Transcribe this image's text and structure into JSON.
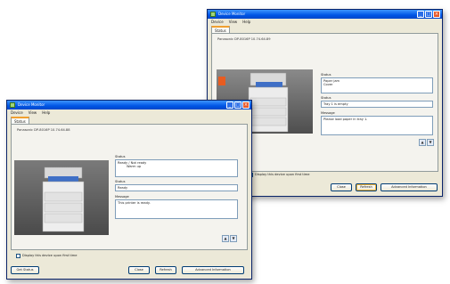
{
  "back": {
    "title": "Device Monitor",
    "menu": [
      "Device",
      "View",
      "Help"
    ],
    "tab": "Status",
    "header": "Panasonic DP-8016P 10.74.64.89",
    "status_label": "Status",
    "status_value": [
      "Paper jam",
      "Cover"
    ],
    "status2_label": "Status",
    "status2_value": "Tray 1 is empty",
    "message_label": "Message",
    "message_value": "Please load paper in tray 1.",
    "checkbox_label": "Display this device upon first time",
    "buttons": {
      "close": "Close",
      "refresh": "Refresh",
      "advanced": "Advanced Information"
    },
    "scroll": {
      "up": "▲",
      "down": "▼"
    }
  },
  "front": {
    "title": "Device Monitor",
    "menu": [
      "Device",
      "View",
      "Help"
    ],
    "tab": "Status",
    "header": "Panasonic DP-8016P 10.74.64.88",
    "status_label": "Status",
    "status_value": [
      "Ready / Not ready",
      "Warm up"
    ],
    "status2_label": "Status",
    "status2_value": "Ready",
    "message_label": "Message",
    "message_value": "This printer is ready.",
    "checkbox_label": "Display this device upon first time",
    "buttons": {
      "status": "Get Status",
      "close": "Close",
      "refresh": "Refresh",
      "advanced": "Advanced Information"
    },
    "scroll": {
      "up": "▲",
      "down": "▼"
    }
  },
  "colors": {
    "title_bar": "#0055e5",
    "window_bg": "#ece9d8",
    "close_button": "#e65a2c"
  }
}
